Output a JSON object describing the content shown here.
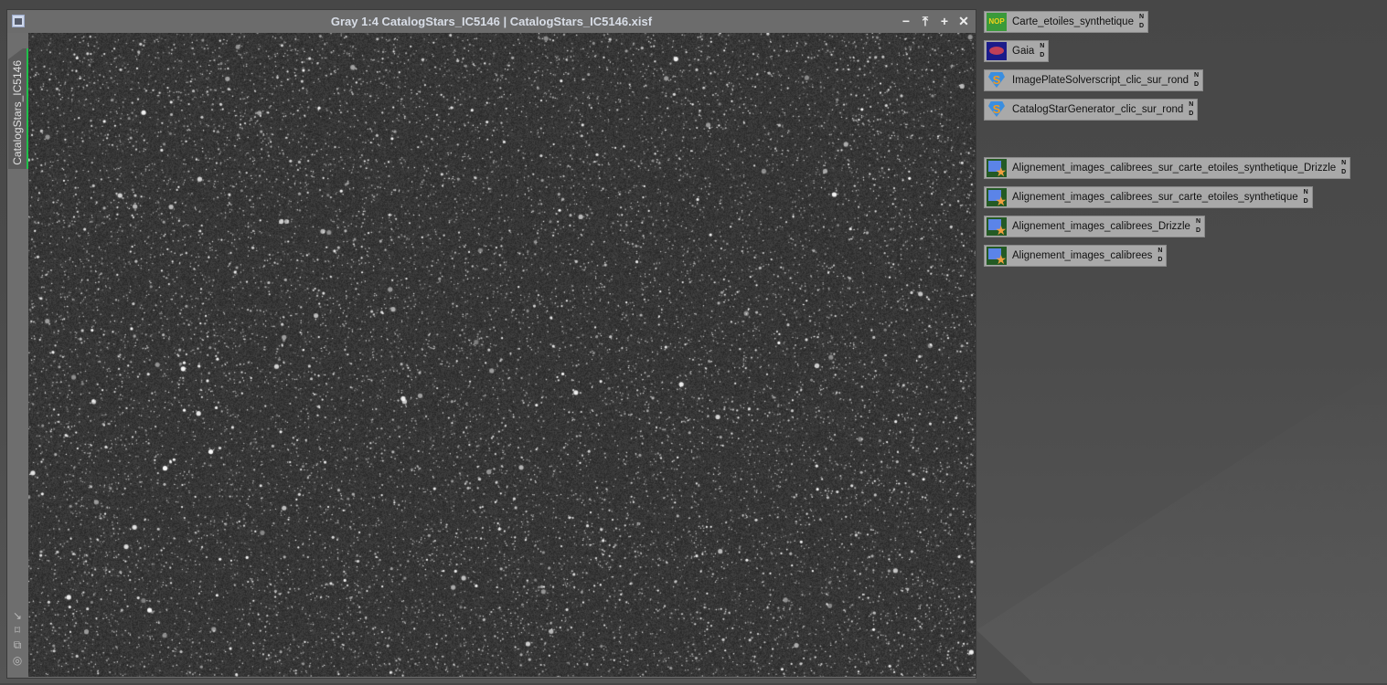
{
  "window": {
    "title": "Gray 1:4 CatalogStars_IC5146 | CatalogStars_IC5146.xisf",
    "view_tab": "CatalogStars_IC5146",
    "controls": {
      "minimize": "−",
      "shade": "⤒",
      "maximize": "+",
      "close": "✕"
    },
    "tools": [
      "↘",
      "⌑",
      "⧉",
      "◎"
    ]
  },
  "process_icons": [
    {
      "label": "Carte_etoiles_synthetique",
      "icon": "nop-icon",
      "nd": [
        "N",
        "D"
      ]
    },
    {
      "label": "Gaia",
      "icon": "gaia-icon",
      "nd": [
        "N",
        "D"
      ]
    },
    {
      "label": "ImagePlateSolverscript_clic_sur_rond",
      "icon": "script-icon",
      "nd": [
        "N",
        "D"
      ]
    },
    {
      "label": "CatalogStarGenerator_clic_sur_rond",
      "icon": "script-icon",
      "nd": [
        "N",
        "D"
      ]
    },
    {
      "label": "Alignement_images_calibrees_sur_carte_etoiles_synthetique_Drizzle",
      "icon": "star-alignment-icon",
      "nd": [
        "N",
        "D"
      ]
    },
    {
      "label": "Alignement_images_calibrees_sur_carte_etoiles_synthetique",
      "icon": "star-alignment-icon",
      "nd": [
        "N",
        "D"
      ]
    },
    {
      "label": "Alignement_images_calibrees_Drizzle",
      "icon": "star-alignment-icon",
      "nd": [
        "N",
        "D"
      ]
    },
    {
      "label": "Alignement_images_calibrees",
      "icon": "star-alignment-icon",
      "nd": [
        "N",
        "D"
      ]
    }
  ],
  "nop_text": "NOP"
}
